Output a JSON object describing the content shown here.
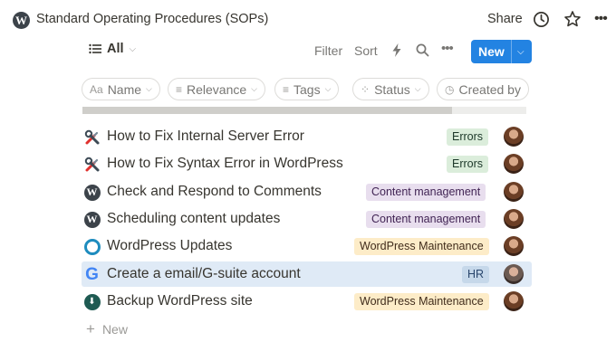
{
  "topbar": {
    "logo": "wordpress-logo",
    "title": "Standard Operating Procedures (SOPs)",
    "share_label": "Share",
    "icons": [
      "clock-icon",
      "star-icon",
      "more-icon"
    ]
  },
  "toolbar": {
    "view_label": "All",
    "filter_label": "Filter",
    "sort_label": "Sort",
    "new_label": "New",
    "accent": "#2383e2"
  },
  "properties": [
    {
      "icon": "Aa",
      "label": "Name"
    },
    {
      "icon": "≡",
      "label": "Relevance"
    },
    {
      "icon": "≡",
      "label": "Tags"
    },
    {
      "icon": "⁘",
      "label": "Status"
    },
    {
      "icon": "◷",
      "label": "Created by"
    }
  ],
  "rows": [
    {
      "icon": "tools-icon",
      "title": "How to Fix Internal Server Error",
      "tag": "Errors",
      "tag_color": "green"
    },
    {
      "icon": "tools-icon",
      "title": "How to Fix Syntax Error in WordPress",
      "tag": "Errors",
      "tag_color": "green"
    },
    {
      "icon": "wordpress-icon",
      "title": "Check and Respond to Comments",
      "tag": "Content management",
      "tag_color": "purple"
    },
    {
      "icon": "wordpress-icon",
      "title": "Scheduling content updates",
      "tag": "Content management",
      "tag_color": "purple"
    },
    {
      "icon": "update-icon",
      "title": "WordPress Updates",
      "tag": "WordPress Maintenance",
      "tag_color": "orange"
    },
    {
      "icon": "google-icon",
      "title": "Create a email/G-suite account",
      "tag": "HR",
      "tag_color": "blue",
      "selected": true
    },
    {
      "icon": "backup-icon",
      "title": "Backup WordPress site",
      "tag": "WordPress Maintenance",
      "tag_color": "orange"
    }
  ],
  "new_row_label": "New",
  "tag_colors": {
    "green": "#dbeddb",
    "purple": "#e8deee",
    "orange": "#fdecc8",
    "blue": "#c6d8ea"
  }
}
